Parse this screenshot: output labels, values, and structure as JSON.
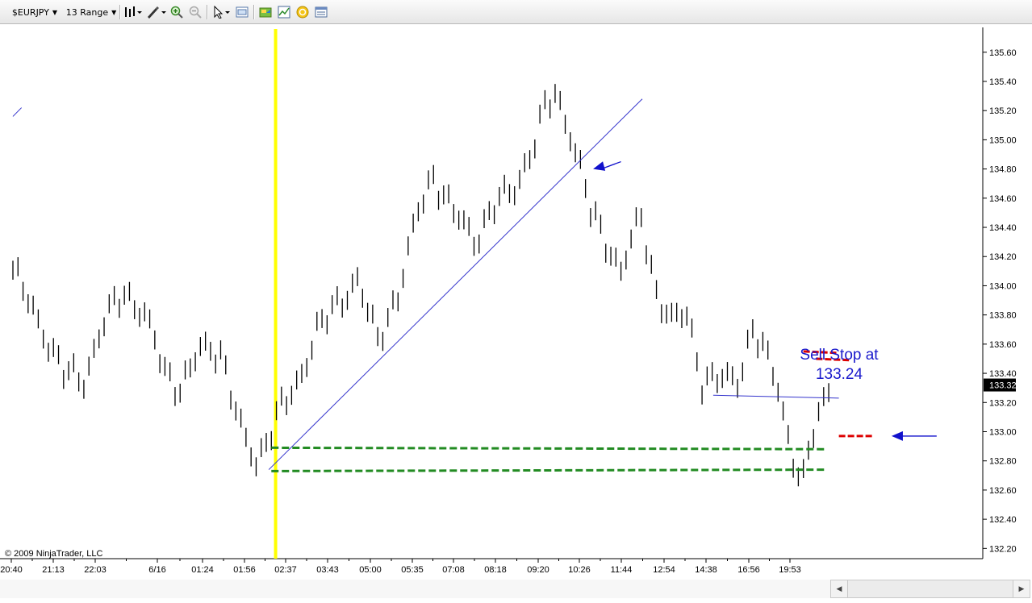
{
  "toolbar": {
    "instrument": "$EURJPY",
    "period": "13 Range",
    "icons": [
      "bar-style-icon",
      "drawing-tools-icon",
      "zoom-in-icon",
      "zoom-out-icon",
      "pointer-icon",
      "properties-icon",
      "data-box-icon",
      "chart-trader-icon",
      "strategies-icon",
      "indicators-icon"
    ]
  },
  "copyright": "© 2009 NinjaTrader, LLC",
  "colors": {
    "trendline": "#3333cc",
    "arrow": "#1111cc",
    "vline": "#ffff00",
    "green": "#228b22",
    "red": "#dd0000",
    "annotation": "#1a1acc"
  },
  "chart_data": {
    "type": "bar",
    "title": "",
    "ylim": [
      132.13,
      135.77
    ],
    "y_ticks": [
      "132.20",
      "132.40",
      "132.60",
      "132.80",
      "133.00",
      "133.20",
      "133.40",
      "133.60",
      "133.80",
      "134.00",
      "134.20",
      "134.40",
      "134.60",
      "134.80",
      "135.00",
      "135.20",
      "135.40",
      "135.60"
    ],
    "x_ticks": [
      "20:40",
      "21:13",
      "22:03",
      "6/16",
      "01:24",
      "01:56",
      "02:37",
      "03:43",
      "05:00",
      "05:35",
      "07:08",
      "08:18",
      "09:20",
      "10:26",
      "11:44",
      "12:54",
      "14:38",
      "16:56",
      "19:53"
    ],
    "last_price": "133.32",
    "anchors": [
      [
        0,
        134.1
      ],
      [
        5,
        133.75
      ],
      [
        10,
        133.4
      ],
      [
        14,
        133.35
      ],
      [
        18,
        133.75
      ],
      [
        22,
        133.95
      ],
      [
        26,
        133.8
      ],
      [
        30,
        133.4
      ],
      [
        33,
        133.3
      ],
      [
        37,
        133.55
      ],
      [
        41,
        133.55
      ],
      [
        45,
        133.0
      ],
      [
        48,
        132.78
      ],
      [
        52,
        133.1
      ],
      [
        56,
        133.3
      ],
      [
        60,
        133.7
      ],
      [
        64,
        133.85
      ],
      [
        68,
        134.05
      ],
      [
        72,
        133.6
      ],
      [
        76,
        133.95
      ],
      [
        80,
        134.5
      ],
      [
        83,
        134.75
      ],
      [
        87,
        134.5
      ],
      [
        91,
        134.3
      ],
      [
        95,
        134.55
      ],
      [
        99,
        134.65
      ],
      [
        102,
        134.9
      ],
      [
        105,
        135.2
      ],
      [
        107,
        135.3
      ],
      [
        110,
        135.05
      ],
      [
        112,
        134.8
      ],
      [
        114,
        134.5
      ],
      [
        117,
        134.3
      ],
      [
        120,
        134.1
      ],
      [
        122,
        134.3
      ],
      [
        124,
        134.45
      ],
      [
        127,
        133.95
      ],
      [
        130,
        133.75
      ],
      [
        133,
        133.8
      ],
      [
        136,
        133.35
      ],
      [
        140,
        133.35
      ],
      [
        143,
        133.35
      ],
      [
        146,
        133.7
      ],
      [
        148,
        133.55
      ],
      [
        150,
        133.4
      ],
      [
        151,
        133.3
      ],
      [
        154,
        132.8
      ],
      [
        156,
        132.65
      ],
      [
        158,
        133.0
      ],
      [
        160,
        133.2
      ],
      [
        161,
        133.32
      ]
    ],
    "bars_count": 162,
    "vertical_line_bar": 52,
    "trendlines": [
      {
        "from": [
          50.5,
          132.74
        ],
        "to": [
          124.2,
          135.28
        ]
      },
      {
        "from": [
          138.2,
          133.25
        ],
        "to": [
          163,
          133.23
        ]
      },
      {
        "from": [
          0,
          135.16
        ],
        "to": [
          1.7,
          135.22
        ]
      }
    ],
    "support_lines": [
      {
        "from": [
          51,
          132.89
        ],
        "to": [
          160.5,
          132.88
        ]
      },
      {
        "from": [
          51,
          132.73
        ],
        "to": [
          160.5,
          132.74
        ]
      }
    ],
    "stop_lines": [
      {
        "from": [
          156,
          133.55
        ],
        "to": [
          162.5,
          133.54
        ]
      },
      {
        "from": [
          158.5,
          133.5
        ],
        "to": [
          165,
          133.49
        ]
      },
      {
        "from": [
          163,
          132.97
        ],
        "to": [
          170,
          132.97
        ]
      }
    ],
    "arrows": [
      {
        "from": [
          120,
          134.85
        ],
        "to": [
          114.5,
          134.8
        ]
      },
      {
        "from": [
          182.3,
          132.97
        ],
        "to": [
          173.4,
          132.97
        ]
      }
    ],
    "annotation": {
      "line1": "Sell Stop at",
      "line2": "133.24"
    }
  }
}
